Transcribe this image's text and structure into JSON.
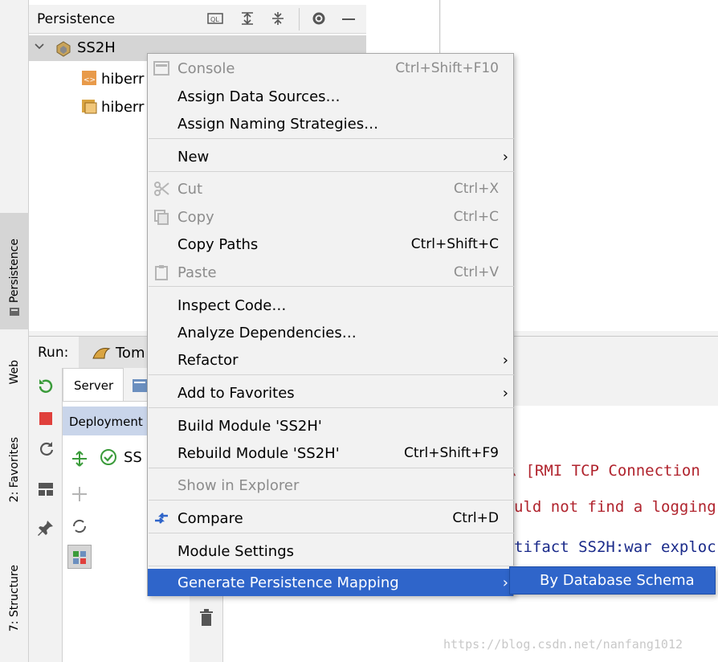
{
  "persistence_panel": {
    "title": "Persistence",
    "tree": {
      "root": "SS2H",
      "children": [
        "hiberr",
        "hiberr"
      ]
    }
  },
  "left_strip": {
    "tabs": [
      "Persistence",
      "Web",
      "2: Favorites",
      "7: Structure"
    ]
  },
  "run_panel": {
    "label": "Run:",
    "config_tab": "Tom",
    "server_tab": "Server",
    "deployment_header": "Deployment",
    "deployment_item": "SS",
    "console_lines": [
      "息 [RMI TCP Connection",
      "uld not find a logging",
      "tifact SS2H:war exploc"
    ]
  },
  "context_menu": {
    "items": [
      {
        "label": "Console",
        "shortcut": "Ctrl+Shift+F10",
        "disabled": true
      },
      {
        "label": "Assign Data Sources…",
        "shortcut": ""
      },
      {
        "label": "Assign Naming Strategies…",
        "shortcut": ""
      },
      {
        "label": "New",
        "shortcut": ""
      },
      {
        "label": "Cut",
        "shortcut": "Ctrl+X",
        "disabled": true
      },
      {
        "label": "Copy",
        "shortcut": "Ctrl+C",
        "disabled": true
      },
      {
        "label": "Copy Paths",
        "shortcut": "Ctrl+Shift+C"
      },
      {
        "label": "Paste",
        "shortcut": "Ctrl+V",
        "disabled": true
      },
      {
        "label": "Inspect Code…",
        "shortcut": ""
      },
      {
        "label": "Analyze Dependencies…",
        "shortcut": ""
      },
      {
        "label": "Refactor",
        "shortcut": ""
      },
      {
        "label": "Add to Favorites",
        "shortcut": ""
      },
      {
        "label": "Build Module 'SS2H'",
        "shortcut": ""
      },
      {
        "label": "Rebuild Module 'SS2H'",
        "shortcut": "Ctrl+Shift+F9"
      },
      {
        "label": "Show in Explorer",
        "shortcut": "",
        "disabled": true
      },
      {
        "label": "Compare",
        "shortcut": "Ctrl+D"
      },
      {
        "label": "Module Settings",
        "shortcut": ""
      },
      {
        "label": "Generate Persistence Mapping",
        "shortcut": "",
        "selected": true
      }
    ]
  },
  "submenu": {
    "label": "By Database Schema"
  },
  "watermark": "https://blog.csdn.net/nanfang1012",
  "colors": {
    "selection": "#2f65ca",
    "console_text": "#b0232d",
    "menu_bg": "#f2f2f2"
  }
}
